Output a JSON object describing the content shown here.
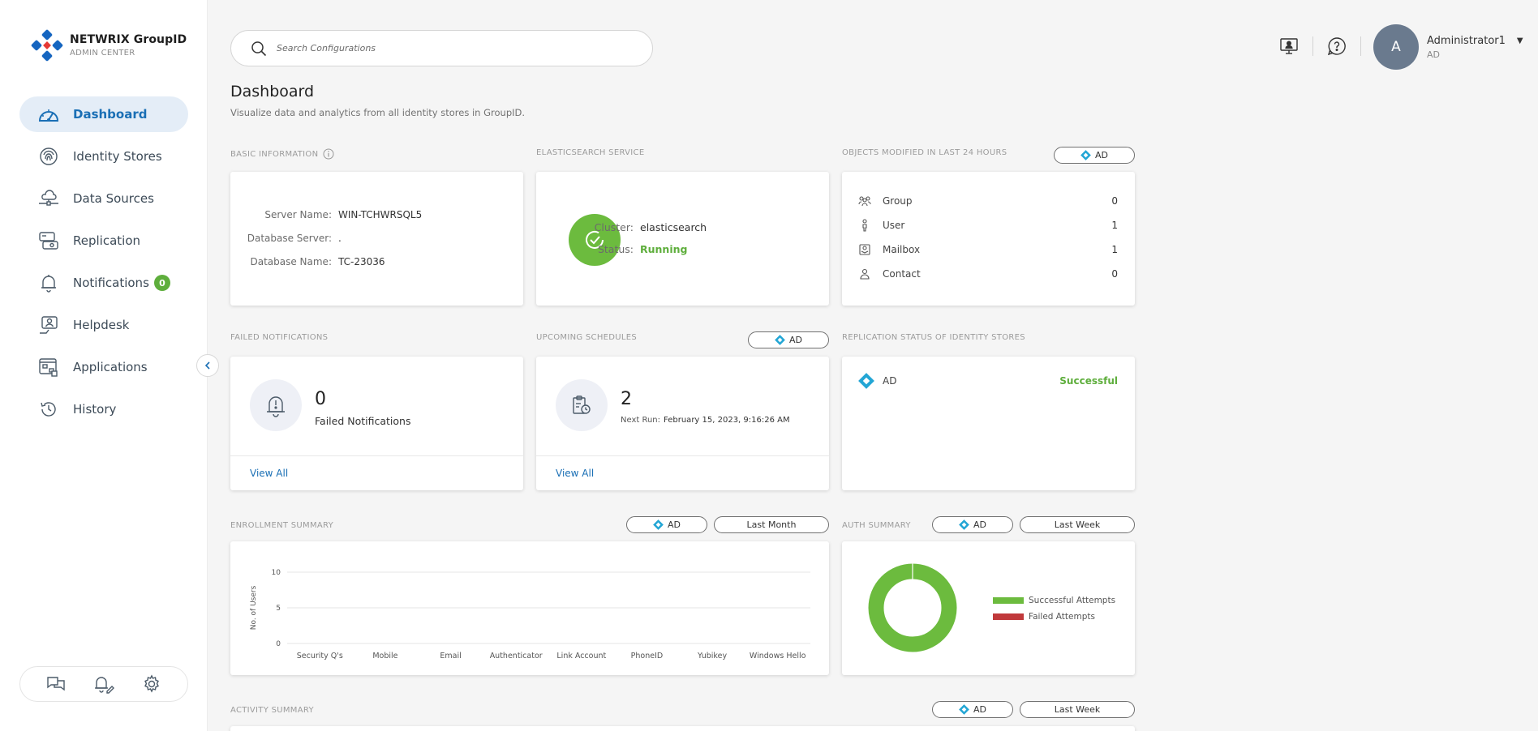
{
  "brand": {
    "name": "NETWRIX GroupID",
    "sub": "ADMIN CENTER"
  },
  "search": {
    "placeholder": "Search Configurations"
  },
  "nav": [
    {
      "label": "Dashboard",
      "icon": "gauge-icon",
      "active": true
    },
    {
      "label": "Identity Stores",
      "icon": "fingerprint-icon"
    },
    {
      "label": "Data Sources",
      "icon": "cloud-connection-icon"
    },
    {
      "label": "Replication",
      "icon": "replication-icon"
    },
    {
      "label": "Notifications",
      "icon": "bell-icon",
      "badge": "0"
    },
    {
      "label": "Helpdesk",
      "icon": "helpdesk-icon"
    },
    {
      "label": "Applications",
      "icon": "applications-icon"
    },
    {
      "label": "History",
      "icon": "history-icon"
    }
  ],
  "user": {
    "initial": "A",
    "name": "Administrator1",
    "sub": "AD"
  },
  "page": {
    "title": "Dashboard",
    "subtitle": "Visualize data and analytics from all identity stores in GroupID."
  },
  "basic_info": {
    "label": "BASIC INFORMATION",
    "server_name_key": "Server Name:",
    "server_name": "WIN-TCHWRSQL5",
    "db_server_key": "Database Server:",
    "db_server": ".",
    "db_name_key": "Database Name:",
    "db_name": "TC-23036"
  },
  "elastic": {
    "label": "ELASTICSEARCH SERVICE",
    "cluster_key": "Cluster:",
    "cluster": "elasticsearch",
    "status_key": "Status:",
    "status": "Running",
    "status_color": "#5eae3c"
  },
  "objects": {
    "label": "OBJECTS MODIFIED IN LAST 24 HOURS",
    "filter": "AD",
    "rows": [
      {
        "name": "Group",
        "count": "0"
      },
      {
        "name": "User",
        "count": "1"
      },
      {
        "name": "Mailbox",
        "count": "1"
      },
      {
        "name": "Contact",
        "count": "0"
      }
    ]
  },
  "failed_notifications": {
    "label": "FAILED NOTIFICATIONS",
    "count": "0",
    "caption": "Failed Notifications",
    "view_all": "View All"
  },
  "schedules": {
    "label": "UPCOMING SCHEDULES",
    "filter": "AD",
    "count": "2",
    "next_run_label": "Next Run:",
    "next_run": "February 15, 2023, 9:16:26 AM",
    "view_all": "View All"
  },
  "replication": {
    "label": "REPLICATION STATUS OF IDENTITY STORES",
    "store": "AD",
    "status": "Successful"
  },
  "enrollment": {
    "label": "ENROLLMENT SUMMARY",
    "filter_store": "AD",
    "filter_period": "Last Month"
  },
  "auth": {
    "label": "AUTH SUMMARY",
    "filter_store": "AD",
    "filter_period": "Last Week"
  },
  "activity": {
    "label": "ACTIVITY SUMMARY",
    "filter_store": "AD",
    "filter_period": "Last Week"
  },
  "chart_data": [
    {
      "type": "bar",
      "categories": [
        "Security Q's",
        "Mobile",
        "Email",
        "Authenticator",
        "Link Account",
        "PhoneID",
        "Yubikey",
        "Windows Hello"
      ],
      "values": [
        0,
        0,
        0,
        0,
        0,
        0,
        0,
        0
      ],
      "title": "",
      "xlabel": "",
      "ylabel": "No. of Users",
      "ylim": [
        0,
        10
      ],
      "yticks": [
        0,
        5,
        10
      ],
      "grid": true
    },
    {
      "type": "pie",
      "donut": true,
      "labels": [
        "Successful Attempts",
        "Failed Attempts"
      ],
      "values": [
        100,
        0
      ],
      "colors": [
        "#6cbb3e",
        "#c0393b"
      ],
      "legend": "right"
    }
  ]
}
